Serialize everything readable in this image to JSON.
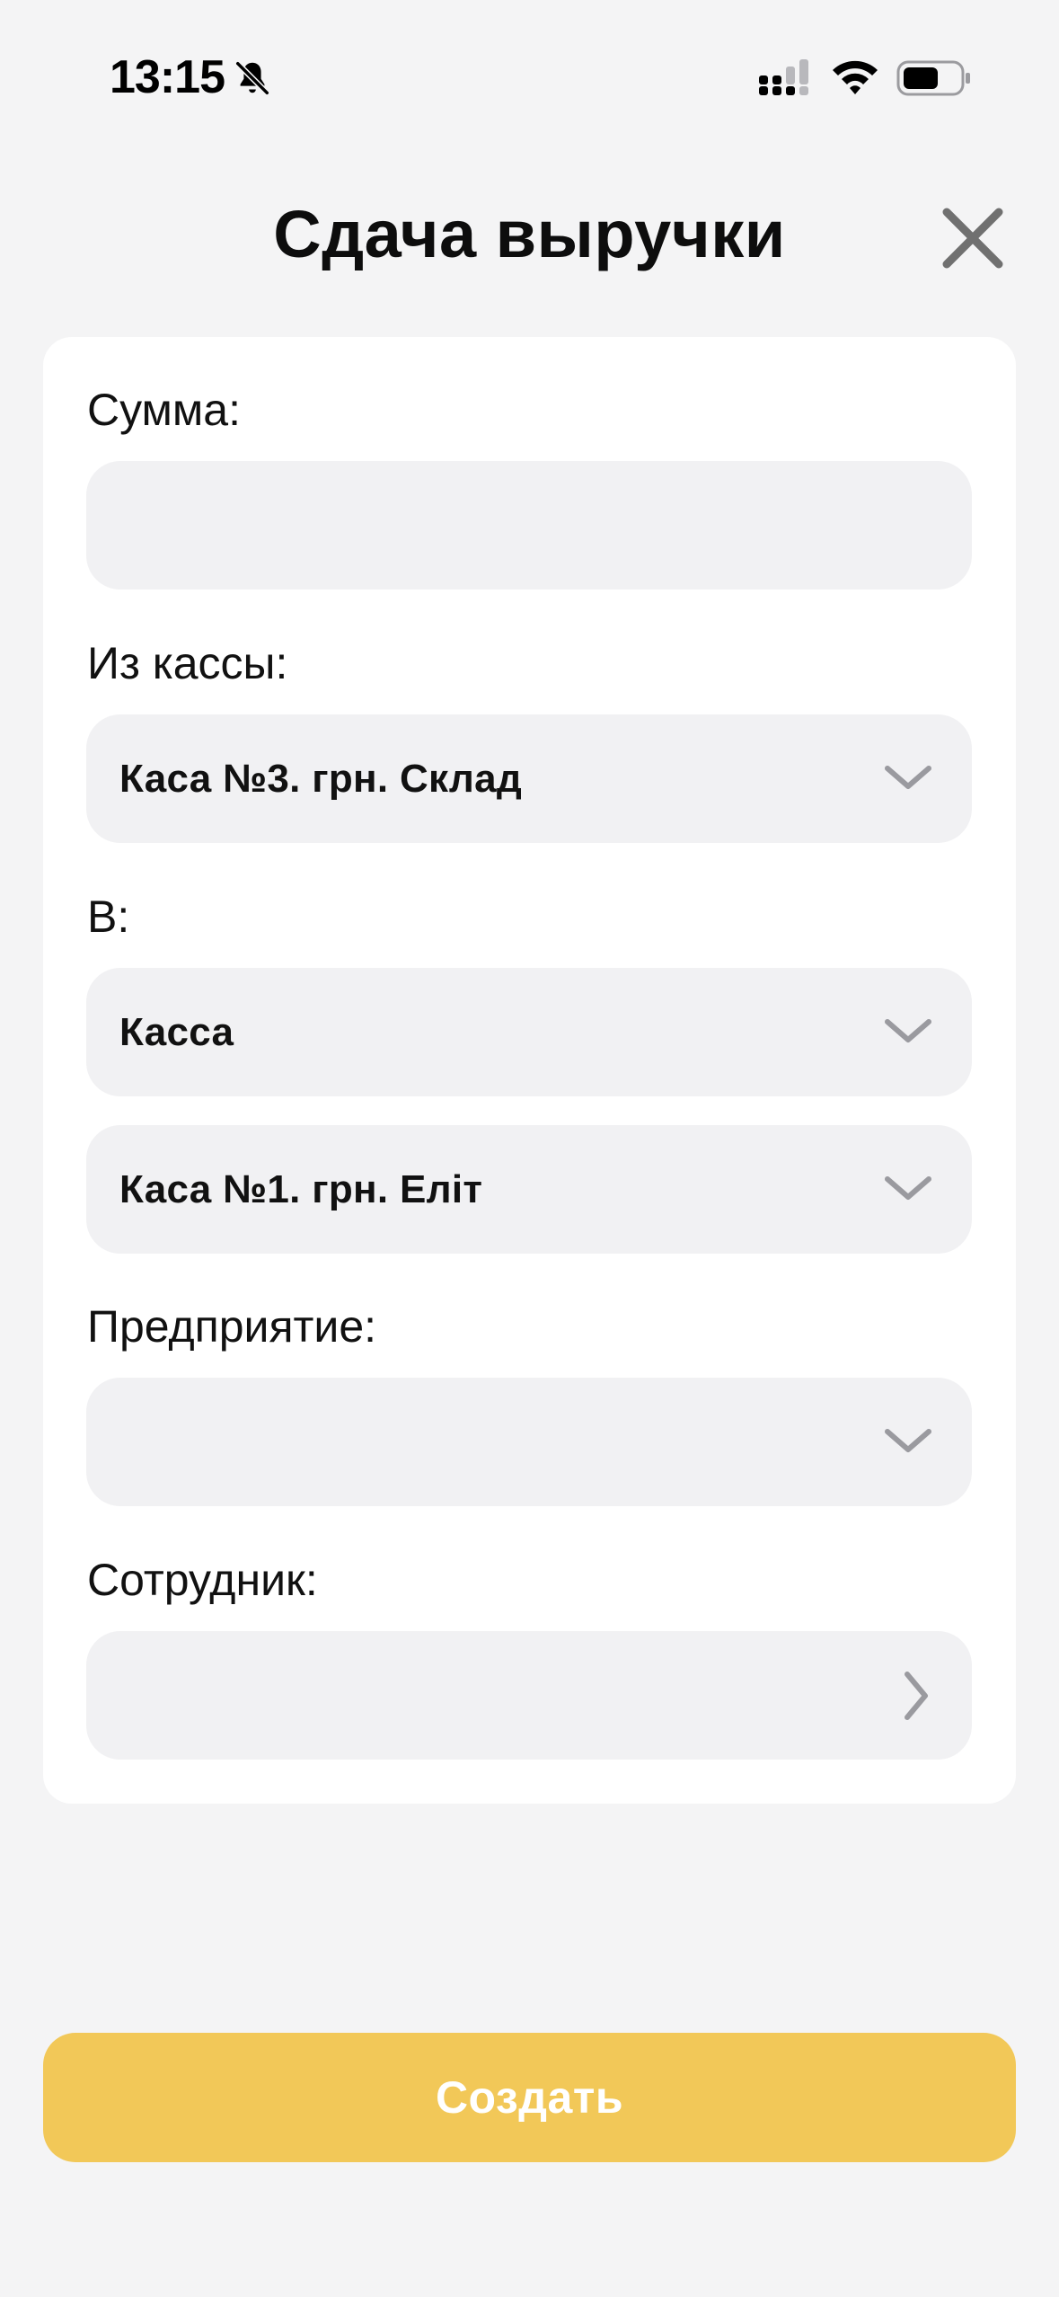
{
  "status_bar": {
    "time": "13:15"
  },
  "header": {
    "title": "Сдача выручки"
  },
  "form": {
    "amount": {
      "label": "Сумма:",
      "value": ""
    },
    "from_cashbox": {
      "label": "Из кассы:",
      "value": "Каса №3. грн. Склад"
    },
    "to": {
      "label": "В:",
      "type_value": "Касса",
      "cashbox_value": "Каса №1. грн. Еліт"
    },
    "enterprise": {
      "label": "Предприятие:",
      "value": ""
    },
    "employee": {
      "label": "Сотрудник:",
      "value": ""
    }
  },
  "actions": {
    "create_label": "Создать"
  },
  "colors": {
    "background": "#f4f4f5",
    "card": "#ffffff",
    "field": "#f1f1f3",
    "accent": "#f2c858",
    "chevron": "#9a9a9f"
  },
  "icons": {
    "status": [
      "bell-slash-icon",
      "signal-icon",
      "wifi-icon",
      "battery-icon"
    ],
    "header": "close-icon",
    "dropdown": "chevron-down-icon",
    "navigate": "chevron-right-icon"
  }
}
